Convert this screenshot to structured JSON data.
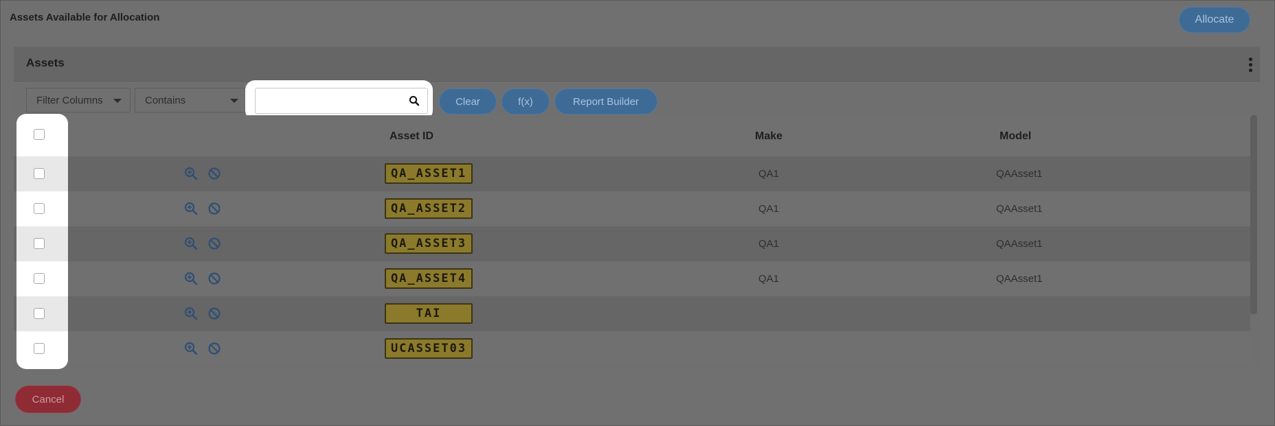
{
  "page": {
    "title": "Assets Available for Allocation",
    "allocate_label": "Allocate",
    "cancel_label": "Cancel"
  },
  "panel": {
    "title": "Assets",
    "menu_icon": "kebab-vertical-icon"
  },
  "toolbar": {
    "filter_columns": "Filter Columns",
    "operator": "Contains",
    "search_value": "",
    "search_placeholder": "",
    "search_icon": "search-icon",
    "clear_label": "Clear",
    "fx_label": "f(x)",
    "report_builder_label": "Report Builder"
  },
  "table": {
    "columns": [
      "Asset ID",
      "Make",
      "Model"
    ],
    "rows": [
      {
        "asset_id": "QA_ASSET1",
        "make": "QA1",
        "model": "QAAsset1"
      },
      {
        "asset_id": "QA_ASSET2",
        "make": "QA1",
        "model": "QAAsset1"
      },
      {
        "asset_id": "QA_ASSET3",
        "make": "QA1",
        "model": "QAAsset1"
      },
      {
        "asset_id": "QA_ASSET4",
        "make": "QA1",
        "model": "QAAsset1"
      },
      {
        "asset_id": "TAI",
        "make": "",
        "model": ""
      },
      {
        "asset_id": "UCASSET03",
        "make": "",
        "model": ""
      }
    ],
    "row_icons": [
      "zoom-in-icon",
      "block-icon"
    ]
  },
  "colors": {
    "accent": "#3e6a96",
    "danger": "#8e2b35",
    "plate": "#8c7a2c"
  }
}
